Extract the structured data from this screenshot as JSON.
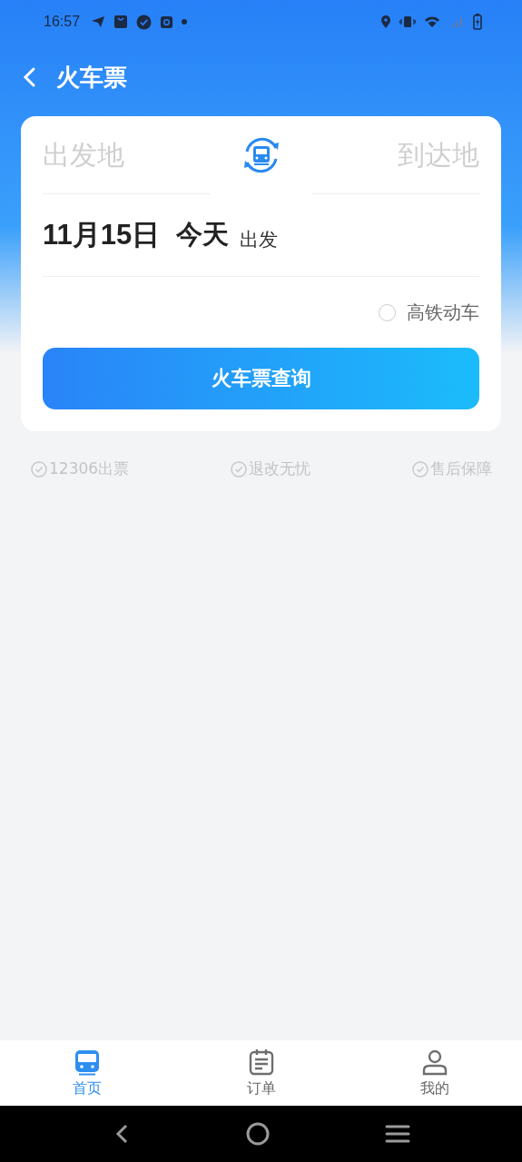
{
  "status_bar": {
    "time": "16:57"
  },
  "header": {
    "title": "火车票"
  },
  "search": {
    "from": {
      "placeholder": "出发地"
    },
    "to": {
      "placeholder": "到达地"
    },
    "date": "11月15日",
    "day": "今天",
    "date_suffix": "出发",
    "high_speed": {
      "label": "高铁动车",
      "checked": false
    },
    "button": "火车票查询"
  },
  "features": [
    "12306出票",
    "退改无忧",
    "售后保障"
  ],
  "tabs": [
    {
      "label": "首页",
      "kind": "train",
      "selected": true
    },
    {
      "label": "订单",
      "kind": "orders",
      "selected": false
    },
    {
      "label": "我的",
      "kind": "profile",
      "selected": false
    }
  ]
}
